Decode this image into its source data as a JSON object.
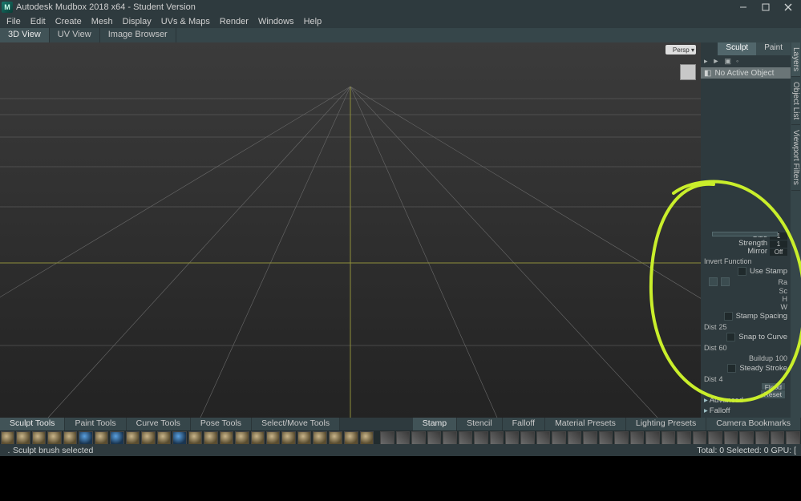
{
  "window": {
    "title": "Autodesk Mudbox 2018 x64 - Student Version",
    "app_icon_label": "M"
  },
  "menubar": [
    "File",
    "Edit",
    "Create",
    "Mesh",
    "Display",
    "UVs & Maps",
    "Render",
    "Windows",
    "Help"
  ],
  "viewtabs": {
    "items": [
      "3D View",
      "UV View",
      "Image Browser"
    ],
    "active_index": 0
  },
  "viewport": {
    "axis_widget_label": "Persp ▾"
  },
  "side_panel_tabs": [
    "Layers",
    "Object List",
    "Viewport Filters"
  ],
  "right_tabs": {
    "items": [
      "Sculpt",
      "Paint"
    ],
    "active_index": 0
  },
  "right_icons_row": [
    "▸",
    "►",
    "▣",
    "◦"
  ],
  "layer_slot": "No Active Object",
  "props": {
    "size_label": "Size",
    "size_value": "1",
    "strength_label": "Strength",
    "strength_value": "1",
    "mirror_label": "Mirror",
    "mirror_value": "Off",
    "invert_label": "Invert Function",
    "use_stamp": "Use Stamp",
    "ra_short": "Ra",
    "orient_label": "Sc",
    "orient_h": "H",
    "orient_w": "W",
    "stamp_spacing": "Stamp Spacing",
    "dist1_label": "Dist",
    "dist1_value": "25",
    "snap_curve": "Snap to Curve",
    "dist2_label": "Dist",
    "dist2_value": "60",
    "buildup_label": "Buildup",
    "buildup_value": "100",
    "steady_stroke": "Steady Stroke",
    "dist3_label": "Dist",
    "dist3_value": "4",
    "flood_btn": "Flood",
    "reset_btn": "Reset",
    "advanced": "Advanced",
    "falloff": "Falloff"
  },
  "tray_left_tabs": [
    "Sculpt Tools",
    "Paint Tools",
    "Curve Tools",
    "Pose Tools",
    "Select/Move Tools"
  ],
  "tray_right_tabs": [
    "Stamp",
    "Stencil",
    "Falloff",
    "Material Presets",
    "Lighting Presets",
    "Camera Bookmarks"
  ],
  "tray_left_active": 0,
  "tray_right_active": 0,
  "statusbar": {
    "left": "Sculpt brush selected",
    "right": "Total: 0  Selected: 0 GPU: [",
    "dot": "."
  }
}
